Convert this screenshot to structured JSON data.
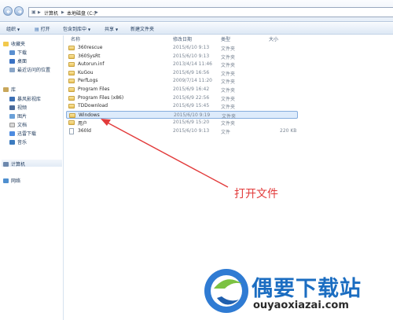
{
  "address": {
    "computer": "计算机",
    "drive": "本地磁盘 (C:)"
  },
  "toolbar": {
    "organize": "组织",
    "open": "打开",
    "include_in_library": "包含到库中",
    "share": "共享",
    "new_folder": "新建文件夹"
  },
  "nav": {
    "favorites": "收藏夹",
    "downloads": "下载",
    "desktop": "桌面",
    "recent": "最近访问的位置",
    "libraries": "库",
    "storm": "暴风影视库",
    "videos": "视频",
    "pictures": "图片",
    "documents": "文档",
    "thunder": "迅雷下载",
    "music": "音乐",
    "computer": "计算机",
    "network": "网络"
  },
  "columns": {
    "name": "名称",
    "date": "修改日期",
    "type": "类型",
    "size": "大小"
  },
  "files": [
    {
      "name": "360rescue",
      "date": "2015/6/10 9:13",
      "type": "文件夹",
      "size": "",
      "kind": "folder"
    },
    {
      "name": "360SysRt",
      "date": "2015/6/10 9:13",
      "type": "文件夹",
      "size": "",
      "kind": "folder"
    },
    {
      "name": "Autorun.inf",
      "date": "2013/4/14 11:46",
      "type": "文件夹",
      "size": "",
      "kind": "folder"
    },
    {
      "name": "KuGou",
      "date": "2015/6/9 16:56",
      "type": "文件夹",
      "size": "",
      "kind": "folder"
    },
    {
      "name": "PerfLogs",
      "date": "2009/7/14 11:20",
      "type": "文件夹",
      "size": "",
      "kind": "folder"
    },
    {
      "name": "Program Files",
      "date": "2015/6/9 16:42",
      "type": "文件夹",
      "size": "",
      "kind": "folder"
    },
    {
      "name": "Program Files (x86)",
      "date": "2015/6/9 22:56",
      "type": "文件夹",
      "size": "",
      "kind": "folder"
    },
    {
      "name": "TDDownload",
      "date": "2015/6/9 15:45",
      "type": "文件夹",
      "size": "",
      "kind": "folder"
    },
    {
      "name": "Windows",
      "date": "2015/6/10 9:19",
      "type": "文件夹",
      "size": "",
      "kind": "folder",
      "selected": true
    },
    {
      "name": "用户",
      "date": "2015/6/9 15:20",
      "type": "文件夹",
      "size": "",
      "kind": "folder"
    },
    {
      "name": "360ld",
      "date": "2015/6/10 9:13",
      "type": "文件",
      "size": "220 KB",
      "kind": "file"
    }
  ],
  "annotation": {
    "label": "打开文件",
    "color": "#e23a3a"
  },
  "watermark": {
    "brand": "偶要下载站",
    "url": "ouyaoxiazai.com"
  }
}
